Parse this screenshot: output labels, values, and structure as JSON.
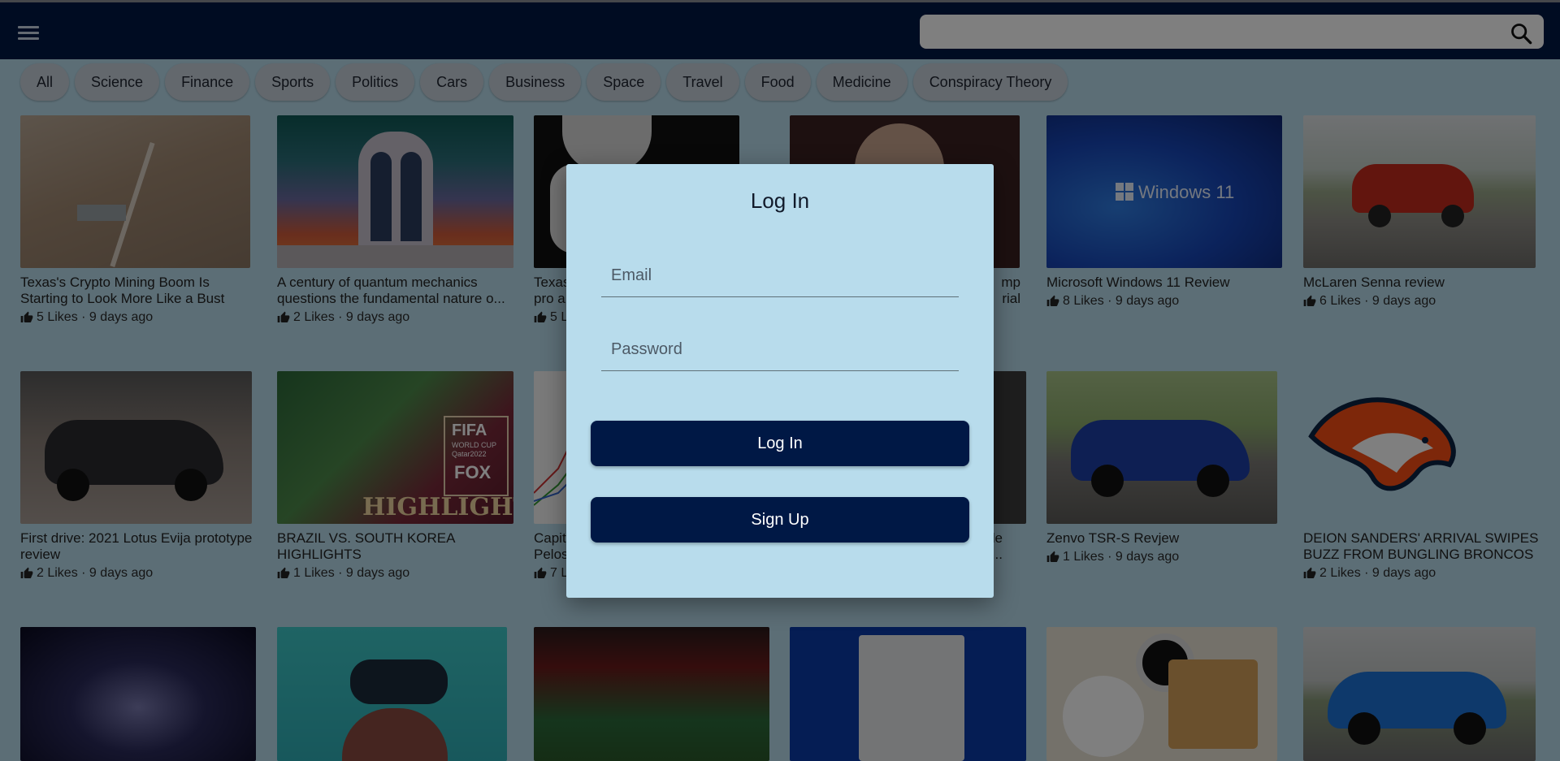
{
  "search": {
    "placeholder": ""
  },
  "categories": [
    "All",
    "Science",
    "Finance",
    "Sports",
    "Politics",
    "Cars",
    "Business",
    "Space",
    "Travel",
    "Food",
    "Medicine",
    "Conspiracy Theory"
  ],
  "articles": [
    {
      "title": "Texas's Crypto Mining Boom Is Starting to Look More Like a Bust",
      "meta": "5 Likes · 9 days ago"
    },
    {
      "title": "A century of quantum mechanics questions the fundamental nature o...",
      "meta": "2 Likes · 9 days ago"
    },
    {
      "title": "Texas",
      "meta": "5 L"
    },
    {
      "title": "",
      "meta": ""
    },
    {
      "title": "Microsoft Windows 11 Review",
      "meta": "8 Likes · 9 days ago"
    },
    {
      "title": "McLaren Senna review",
      "meta": "6 Likes · 9 days ago"
    },
    {
      "title": "First drive: 2021 Lotus Evija prototype review",
      "meta": "2 Likes · 9 days ago"
    },
    {
      "title": "BRAZIL VS. SOUTH KOREA HIGHLIGHTS",
      "meta": "1 Likes · 9 days ago"
    },
    {
      "title": "Capit",
      "meta": "7 L"
    },
    {
      "title": "",
      "meta": ""
    },
    {
      "title": "Zenvo TSR-S Revjew",
      "meta": "1 Likes · 9 days ago"
    },
    {
      "title": "DEION SANDERS' ARRIVAL SWIPES BUZZ FROM BUNGLING BRONCOS",
      "meta": "2 Likes · 9 days ago"
    }
  ],
  "partial_text": {
    "row1_col2_line2": "pro a",
    "row1_col3_line1": "mp",
    "row1_col3_line2": "rial",
    "row2_col2_line2": "Pelos",
    "row2_col3_line1": "de",
    "row2_col3_line2": "..."
  },
  "thumb_text": {
    "windows": "Windows 11",
    "fifa_line1": "FIFA",
    "fifa_line2": "WORLD CUP",
    "fifa_line3": "Qatar2022",
    "fox": "FOX",
    "highlights": "HIGHLIGHTS"
  },
  "modal": {
    "title": "Log In",
    "email_placeholder": "Email",
    "password_placeholder": "Password",
    "login_label": "Log In",
    "signup_label": "Sign Up"
  },
  "colors": {
    "header": "#001845",
    "modal_bg": "#b8dcec",
    "button": "#001845"
  }
}
